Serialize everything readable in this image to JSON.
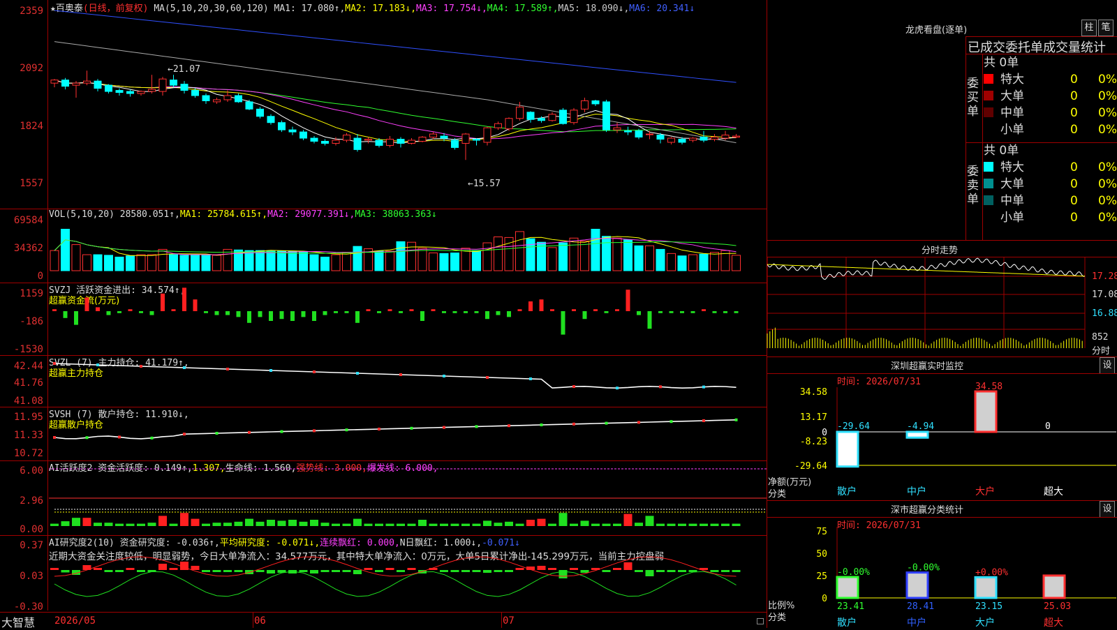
{
  "header": {
    "star": "★",
    "stock_name": "百奥泰",
    "period": "(日线，前复权)",
    "ma_def": "MA(5,10,20,30,60,120)",
    "ma1": "MA1: 17.080↑,",
    "ma2": "MA2: 17.183↓,",
    "ma3": "MA3: 17.754↓,",
    "ma4": "MA4: 17.589↑,",
    "ma5": "MA5: 18.090↓,",
    "ma6": "MA6: 20.341↓"
  },
  "price_axis": [
    "2359",
    "2092",
    "1824",
    "1557"
  ],
  "price_annotations": {
    "high": "←21.07",
    "low": "←15.57"
  },
  "vol": {
    "title": "VOL(5,10,20)",
    "value": "28580.051↑,",
    "ma1": "MA1: 25784.615↑,",
    "ma2": "MA2: 29077.391↓,",
    "ma3": "MA3: 38063.363↓",
    "axis": [
      "69584",
      "34362",
      "0"
    ]
  },
  "svzj": {
    "title": "SVZJ  活跃资金进出: 34.574↑,",
    "subtitle": "超赢资金流(万元)",
    "axis": [
      "1159",
      "-186",
      "-1530"
    ]
  },
  "svzl": {
    "title": "SVZL (7) 主力持仓: 41.179↑,",
    "subtitle": "超赢主力持仓",
    "axis": [
      "42.44",
      "41.76",
      "41.08"
    ]
  },
  "svsh": {
    "title": "SVSH (7) 散户持仓: 11.910↓,",
    "subtitle": "超赢散户持仓",
    "axis": [
      "11.95",
      "11.33",
      "10.72"
    ]
  },
  "ai_active": {
    "title_a": "AI活跃度2 资金活跃度: 0.149↑,",
    "title_b": "1.307,",
    "title_c": "生命线: 1.560,",
    "title_d": "强势线: 3.000,",
    "title_e": "爆发线: 6.000,",
    "axis": [
      "6.00",
      "2.96",
      "0.00"
    ]
  },
  "ai_research": {
    "title_a": "AI研究度2(10) 资金研究度: -0.036↑,",
    "title_b": "平均研究度: -0.071↓,",
    "title_c": "连续飘红: 0.000,",
    "title_d": "N日飘红: 1.000↓,",
    "title_e": "-0.071↓",
    "comment": "近期大资金关注度较低，明显弱势，今日大单净流入：34.577万元，其中特大单净流入：0万元，大单5日累计净出-145.299万元，当前主力控盘弱",
    "axis": [
      "0.37",
      "0.03",
      "-0.30"
    ]
  },
  "x_axis": {
    "brand": "大智慧",
    "labels": [
      "2026/05",
      "06",
      "07"
    ]
  },
  "right": {
    "lhb_title": "龙虎看盘(逐单)",
    "btn_column": "柱",
    "btn_stroke": "笔",
    "stats_title": "已成交委托单成交量统计",
    "buy": {
      "label": "委买单",
      "total": "共 0单",
      "rows": [
        {
          "name": "特大",
          "count": "0",
          "pct": "0%",
          "color": "#ff0000"
        },
        {
          "name": "大单",
          "count": "0",
          "pct": "0%",
          "color": "#a00000"
        },
        {
          "name": "中单",
          "count": "0",
          "pct": "0%",
          "color": "#600000"
        },
        {
          "name": "小单",
          "count": "0",
          "pct": "0%",
          "color": "#000000"
        }
      ]
    },
    "sell": {
      "label": "委卖单",
      "total": "共 0单",
      "rows": [
        {
          "name": "特大",
          "count": "0",
          "pct": "0%",
          "color": "#00ffff"
        },
        {
          "name": "大单",
          "count": "0",
          "pct": "0%",
          "color": "#009090"
        },
        {
          "name": "中单",
          "count": "0",
          "pct": "0%",
          "color": "#006060"
        },
        {
          "name": "小单",
          "count": "0",
          "pct": "0%",
          "color": "#000000"
        }
      ]
    },
    "intraday": {
      "title": "分时走势",
      "prices": [
        "17.28",
        "17.08",
        "16.88"
      ],
      "vol": "852",
      "vol_label": "分时"
    },
    "monitor": {
      "title": "深圳超赢实时监控",
      "btn": "设",
      "time": "时间: 2026/07/31",
      "axis": [
        "34.58",
        "13.17",
        "0",
        "-8.23",
        "-29.64"
      ],
      "ylabel": "净额(万元)",
      "xlabel": "分类",
      "bars": [
        {
          "name": "散户",
          "value": "-29.64"
        },
        {
          "name": "中户",
          "value": "-4.94"
        },
        {
          "name": "大户",
          "value": "34.58"
        },
        {
          "name": "超大",
          "value": "0"
        }
      ]
    },
    "classify": {
      "title": "深市超赢分类统计",
      "btn": "设",
      "time": "时间: 2026/07/31",
      "axis": [
        "75",
        "50",
        "25",
        "0"
      ],
      "ylabel": "比例%",
      "xlabel": "分类",
      "bars": [
        {
          "name": "散户",
          "pct": "23.41",
          "change": "-0.00%"
        },
        {
          "name": "中户",
          "pct": "28.41",
          "change": "-0.00%"
        },
        {
          "name": "大户",
          "pct": "23.15",
          "change": "+0.00%"
        },
        {
          "name": "超大",
          "pct": "25.03",
          "change": ""
        }
      ]
    }
  },
  "chart_data": {
    "type": "candlestick",
    "title": "百奥泰",
    "candles": [
      [
        20.2,
        20.35,
        20.0,
        20.4
      ],
      [
        20.35,
        20.05,
        19.9,
        20.45
      ],
      [
        20.1,
        20.2,
        19.5,
        20.3
      ],
      [
        20.2,
        20.3,
        20.1,
        20.8
      ],
      [
        20.3,
        19.95,
        19.8,
        20.4
      ],
      [
        20.1,
        19.8,
        19.7,
        20.15
      ],
      [
        19.85,
        19.75,
        19.6,
        19.95
      ],
      [
        19.8,
        19.7,
        19.55,
        19.9
      ],
      [
        19.7,
        19.8,
        19.6,
        19.85
      ],
      [
        19.8,
        19.9,
        19.7,
        20.6
      ],
      [
        19.8,
        20.4,
        19.6,
        20.5
      ],
      [
        20.35,
        20.1,
        20.0,
        20.6
      ],
      [
        20.15,
        19.85,
        19.7,
        20.3
      ],
      [
        19.85,
        19.6,
        19.5,
        19.95
      ],
      [
        19.6,
        19.35,
        19.2,
        19.7
      ],
      [
        19.3,
        19.4,
        19.2,
        19.5
      ],
      [
        19.4,
        19.6,
        19.3,
        19.85
      ],
      [
        19.6,
        19.3,
        19.25,
        19.7
      ],
      [
        19.3,
        18.95,
        18.9,
        19.4
      ],
      [
        18.95,
        18.6,
        18.5,
        19.05
      ],
      [
        18.6,
        18.3,
        18.2,
        18.7
      ],
      [
        18.3,
        17.95,
        17.85,
        18.4
      ],
      [
        17.95,
        17.85,
        17.7,
        18.1
      ],
      [
        17.85,
        17.55,
        17.45,
        17.95
      ],
      [
        17.55,
        17.4,
        17.3,
        17.65
      ],
      [
        17.4,
        17.3,
        17.2,
        17.5
      ],
      [
        17.3,
        17.45,
        17.2,
        17.6
      ],
      [
        17.45,
        17.7,
        17.35,
        17.8
      ],
      [
        17.55,
        17.0,
        16.9,
        17.75
      ],
      [
        17.45,
        17.5,
        17.3,
        17.6
      ],
      [
        17.45,
        17.2,
        17.1,
        17.55
      ],
      [
        17.2,
        17.5,
        17.1,
        17.65
      ],
      [
        17.5,
        17.3,
        17.1,
        17.6
      ],
      [
        17.3,
        17.45,
        17.25,
        17.55
      ],
      [
        17.4,
        17.6,
        17.35,
        17.65
      ],
      [
        17.6,
        17.75,
        17.5,
        17.85
      ],
      [
        17.65,
        17.55,
        17.4,
        17.8
      ],
      [
        17.45,
        17.1,
        17.0,
        17.55
      ],
      [
        17.3,
        17.75,
        16.5,
        17.8
      ],
      [
        17.5,
        17.45,
        17.2,
        17.55
      ],
      [
        17.35,
        18.05,
        17.2,
        18.1
      ],
      [
        18.05,
        18.25,
        17.95,
        18.35
      ],
      [
        18.0,
        18.5,
        17.9,
        18.55
      ],
      [
        18.5,
        19.05,
        18.4,
        19.3
      ],
      [
        18.8,
        18.45,
        18.3,
        18.85
      ],
      [
        18.5,
        18.4,
        18.3,
        18.6
      ],
      [
        18.4,
        18.7,
        18.35,
        18.8
      ],
      [
        18.9,
        18.25,
        18.2,
        19.0
      ],
      [
        18.3,
        18.9,
        18.2,
        19.0
      ],
      [
        18.95,
        19.35,
        18.8,
        19.5
      ],
      [
        19.35,
        19.2,
        19.1,
        19.4
      ],
      [
        19.3,
        17.95,
        17.85,
        19.4
      ],
      [
        17.95,
        18.05,
        17.8,
        18.3
      ],
      [
        17.9,
        17.85,
        17.7,
        18.1
      ],
      [
        17.9,
        17.6,
        17.5,
        18.0
      ],
      [
        17.75,
        17.75,
        17.5,
        17.9
      ],
      [
        17.7,
        17.5,
        17.3,
        17.8
      ],
      [
        17.35,
        17.55,
        17.25,
        17.6
      ],
      [
        17.5,
        17.35,
        17.25,
        17.6
      ],
      [
        17.45,
        17.55,
        17.35,
        17.6
      ],
      [
        17.6,
        17.45,
        17.35,
        17.9
      ],
      [
        17.5,
        17.6,
        17.4,
        17.75
      ],
      [
        17.55,
        17.7,
        17.45,
        17.9
      ],
      [
        17.6,
        17.65,
        17.55,
        17.75
      ]
    ],
    "ma_lines": [
      "MA1",
      "MA2",
      "MA3",
      "MA4",
      "MA5",
      "MA6"
    ],
    "volume_units": "relative",
    "volumes": [
      34,
      70,
      44,
      27,
      27,
      26,
      23,
      25,
      27,
      27,
      36,
      27,
      26,
      26,
      26,
      26,
      36,
      35,
      34,
      34,
      33,
      33,
      33,
      32,
      27,
      23,
      27,
      31,
      41,
      37,
      33,
      33,
      49,
      48,
      38,
      30,
      29,
      30,
      38,
      34,
      47,
      57,
      56,
      66,
      54,
      48,
      39,
      47,
      55,
      50,
      70,
      58,
      55,
      52,
      42,
      42,
      36,
      29,
      25,
      27,
      28,
      31,
      34,
      26
    ],
    "flow_values": [
      0.1,
      -0.35,
      -0.7,
      0.7,
      0.2,
      -0.2,
      -0.1,
      0.1,
      -0.1,
      -0.2,
      0.9,
      0.1,
      1.2,
      0.6,
      -0.1,
      -0.2,
      -0.2,
      -0.3,
      -0.6,
      -0.3,
      -0.5,
      -0.4,
      -0.5,
      -0.3,
      -0.5,
      -0.2,
      -0.1,
      -0.1,
      -0.6,
      0.1,
      -0.1,
      0.1,
      -0.1,
      0.1,
      -0.5,
      0.1,
      -0.1,
      -0.1,
      -0.1,
      -0.1,
      -0.4,
      -0.2,
      -0.3,
      0.1,
      0.5,
      0.6,
      0.1,
      -1.2,
      0.1,
      -0.4,
      0.1,
      -0.1,
      0.1,
      1.1,
      -0.2,
      -0.9,
      -0.1,
      -0.1,
      -0.1,
      -0.1,
      0.1,
      -0.1,
      -0.1,
      -0.1
    ]
  }
}
